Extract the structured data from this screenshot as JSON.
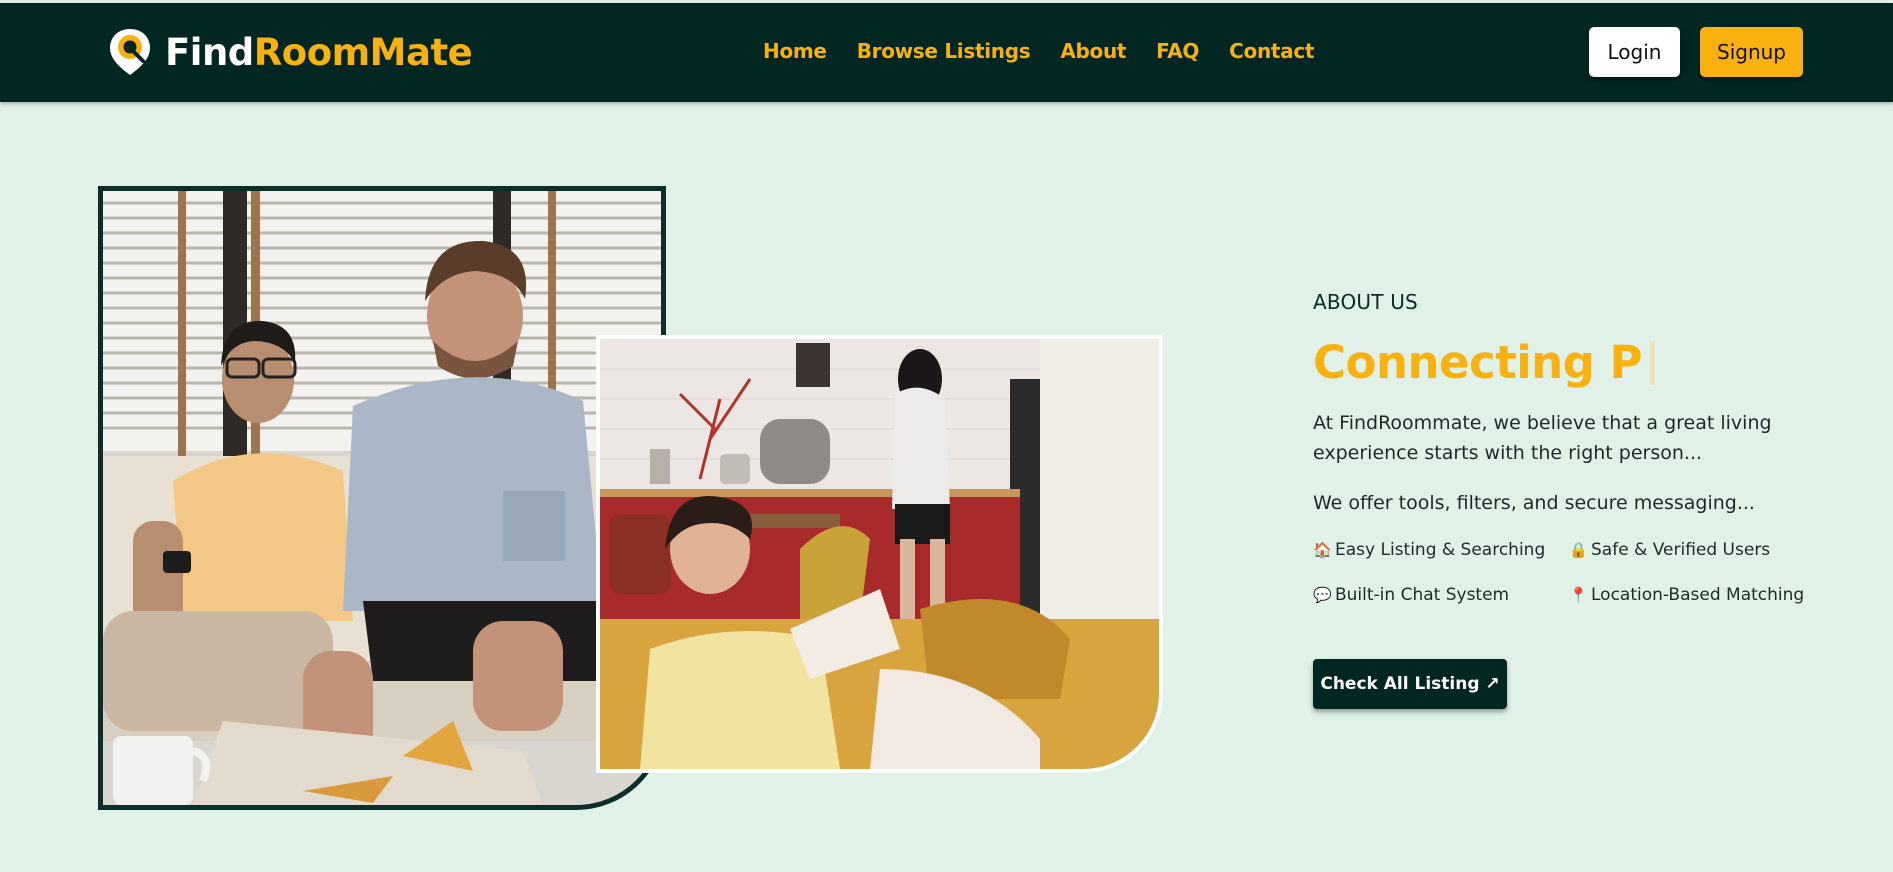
{
  "brand": {
    "find": "Find",
    "roommate": "RoomMate",
    "accent": "#f8b10f",
    "dark": "#022622"
  },
  "nav": {
    "links": [
      "Home",
      "Browse Listings",
      "About",
      "FAQ",
      "Contact"
    ],
    "login": "Login",
    "signup": "Signup"
  },
  "about": {
    "label": "ABOUT US",
    "heading": "Connecting P",
    "para1": "At FindRoommate, we believe that a great living experience starts with the right person...",
    "para2": "We offer tools, filters, and secure messaging...",
    "features": [
      {
        "icon": "house-icon",
        "glyph": "🏠",
        "text": "Easy Listing & Searching"
      },
      {
        "icon": "lock-icon",
        "glyph": "🔒",
        "text": "Safe & Verified Users"
      },
      {
        "icon": "speech-bubble-icon",
        "glyph": "💬",
        "text": "Built-in Chat System"
      },
      {
        "icon": "location-pin-icon",
        "glyph": "📍",
        "text": "Location-Based Matching"
      }
    ],
    "cta": "Check All Listing ↗"
  },
  "background": "#e0f1e8"
}
